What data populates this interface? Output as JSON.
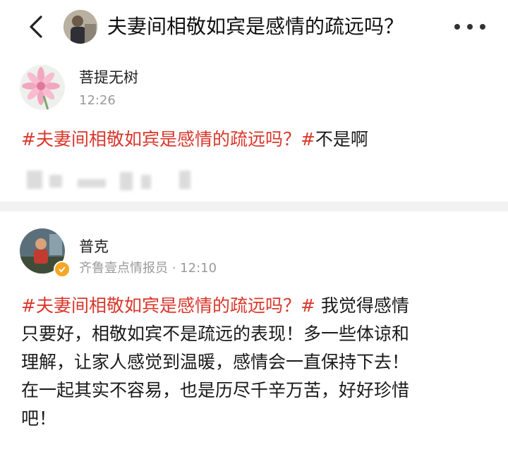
{
  "header": {
    "back_icon": "chevron-left-icon",
    "title": "夫妻间相敬如宾是感情的疏远吗？",
    "more_icon": "more-dots-icon"
  },
  "posts": [
    {
      "author": "菩提无树",
      "time": "12:26",
      "topic": "#夫妻间相敬如宾是感情的疏远吗？#",
      "text": "不是啊"
    },
    {
      "author": "普克",
      "meta": "齐鲁壹点情报员 · 12:10",
      "topic": "#夫妻间相敬如宾是感情的疏远吗？#",
      "lines": [
        " 我觉得感情",
        "只要好，相敬如宾不是疏远的表现！多一些体谅和",
        "理解，让家人感觉到温暖，感情会一直保持下去！",
        "在一起其实不容易，也是历尽千辛万苦，好好珍惜",
        "吧！"
      ]
    }
  ],
  "colors": {
    "topic": "#d9372b",
    "badge": "#f5a623"
  }
}
